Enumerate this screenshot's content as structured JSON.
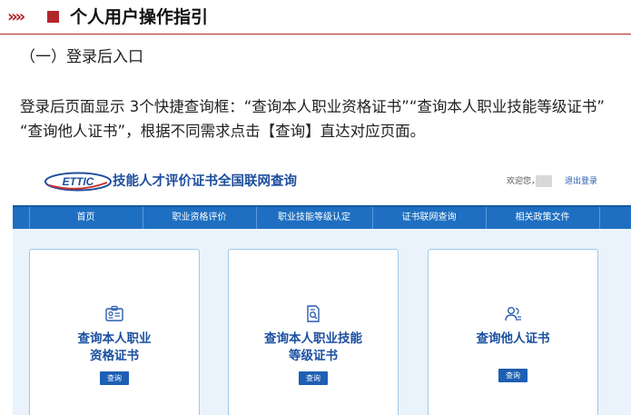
{
  "section": {
    "title": "个人用户操作指引",
    "chevrons": "»»"
  },
  "sub_heading": "（一）登录后入口",
  "paragraph": {
    "line1": "登录后页面显示 3个快捷查询框：“查询本人职业资格证书”“查询本人职业技能等级证书”",
    "line2": "“查询他人证书”，根据不同需求点击【查询】直达对应页面。"
  },
  "site": {
    "logo_badge": "ETTIC",
    "logo_text": "技能人才评价证书全国联网查询",
    "welcome": "欢迎您，",
    "logout": "退出登录",
    "nav": [
      "首页",
      "职业资格评价",
      "职业技能等级认定",
      "证书联网查询",
      "相关政策文件"
    ],
    "cards": [
      {
        "title_line1": "查询本人职业",
        "title_line2": "资格证书",
        "button": "查询",
        "icon": "id-card-icon"
      },
      {
        "title_line1": "查询本人职业技能",
        "title_line2": "等级证书",
        "button": "查询",
        "icon": "document-search-icon"
      },
      {
        "title_line1": "查询他人证书",
        "title_line2": "",
        "button": "查询",
        "icon": "user-group-icon"
      }
    ],
    "colors": {
      "brand_red": "#b3262b",
      "nav_blue": "#1e6fc1",
      "title_blue": "#1a4fa0",
      "card_border": "#9fc8e8"
    }
  }
}
